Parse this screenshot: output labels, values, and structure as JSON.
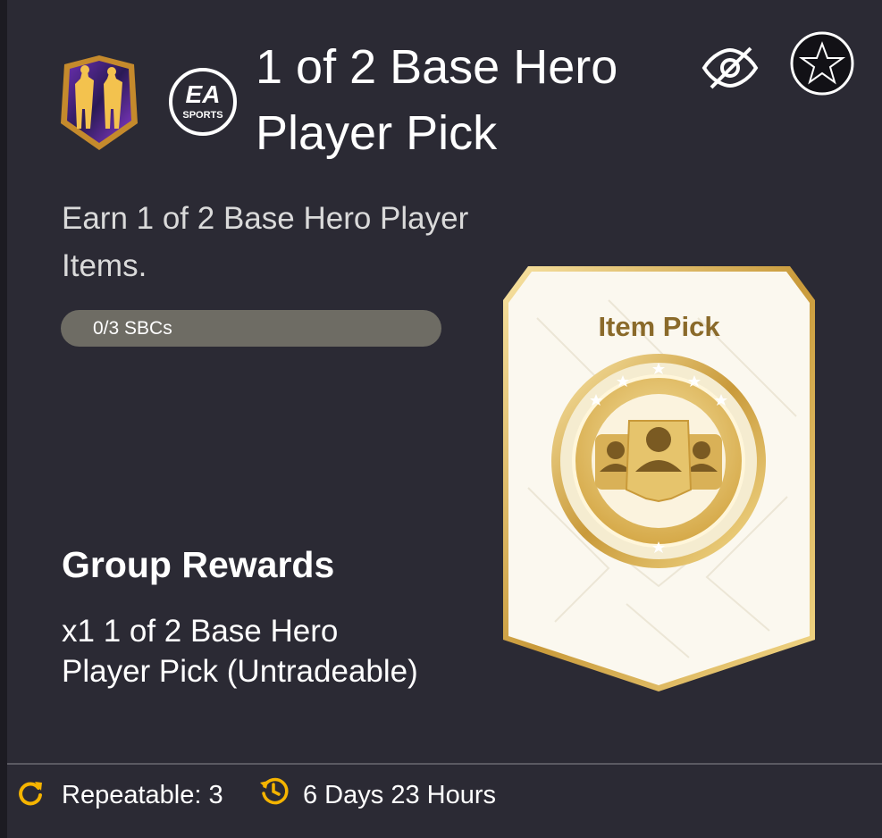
{
  "header": {
    "title": "1 of 2 Base Hero Player Pick",
    "badge_icon": "hero-crest-icon",
    "publisher_logo_text": "SPORTS"
  },
  "description": "Earn 1 of 2 Base Hero Player Items.",
  "progress": {
    "label": "0/3 SBCs",
    "fraction": 0
  },
  "group_rewards": {
    "title": "Group Rewards",
    "reward_text": "x1 1 of 2 Base Hero Player Pick (Untradeable)"
  },
  "reward_card": {
    "label": "Item Pick",
    "icon": "player-pick-icon"
  },
  "footer": {
    "repeatable_label": "Repeatable: 3",
    "time_remaining": "6 Days 23 Hours"
  },
  "colors": {
    "background": "#2b2a34",
    "accent": "#f5b400",
    "gold": "#c99a3a",
    "progress_track": "#6e6c64"
  }
}
